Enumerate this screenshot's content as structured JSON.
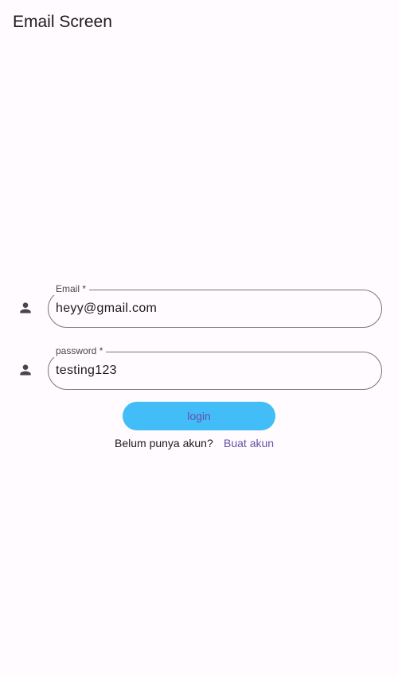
{
  "app_bar": {
    "title": "Email Screen"
  },
  "form": {
    "email": {
      "label": "Email *",
      "value": "heyy@gmail.com",
      "icon": "person-icon"
    },
    "password": {
      "label": "password *",
      "value": "testing123",
      "icon": "person-icon"
    },
    "login_label": "login",
    "signup_prompt": "Belum punya akun?",
    "signup_link": "Buat akun"
  },
  "colors": {
    "background": "#fffbfe",
    "button": "#42bdf8",
    "accent": "#6750a4",
    "outline": "#79747e"
  }
}
